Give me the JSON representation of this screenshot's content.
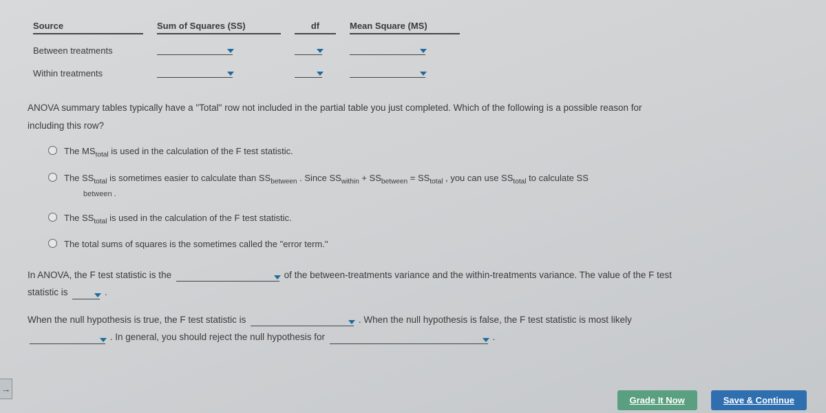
{
  "table": {
    "headers": {
      "source": "Source",
      "ss": "Sum of Squares (SS)",
      "df": "df",
      "ms": "Mean Square (MS)"
    },
    "rows": {
      "between": "Between treatments",
      "within": "Within treatments"
    }
  },
  "question1": {
    "prompt_a": "ANOVA summary tables typically have a \"Total\" row not included in the partial table you just completed. Which of the following is a possible reason for",
    "prompt_b": "including this row?",
    "choices": {
      "c1_a": "The MS",
      "c1_b": " is used in the calculation of the F test statistic.",
      "c2_a": "The SS",
      "c2_b": " is sometimes easier to calculate than SS",
      "c2_c": " . Since SS",
      "c2_d": " + SS",
      "c2_e": " = SS",
      "c2_f": " , you can use SS",
      "c2_g": " to calculate SS",
      "c2_sub": "between .",
      "c3_a": "The SS",
      "c3_b": " is used in the calculation of the F test statistic.",
      "c4": "The total sums of squares is the sometimes called the \"error term.\""
    },
    "subs": {
      "total": "total",
      "between": "between",
      "within": "within"
    }
  },
  "question2": {
    "p1_a": "In ANOVA, the F test statistic is the ",
    "p1_b": " of the between-treatments variance and the within-treatments variance. The value of the F test",
    "p1_c": "statistic is ",
    "p1_d": " ."
  },
  "question3": {
    "p_a": "When the null hypothesis is true, the F test statistic is ",
    "p_b": " . When the null hypothesis is false, the F test statistic is most likely",
    "p_c": " . In general, you should reject the null hypothesis for ",
    "p_d": " ."
  },
  "buttons": {
    "grade": "Grade It Now",
    "save": "Save & Continue"
  },
  "arrow": "→"
}
